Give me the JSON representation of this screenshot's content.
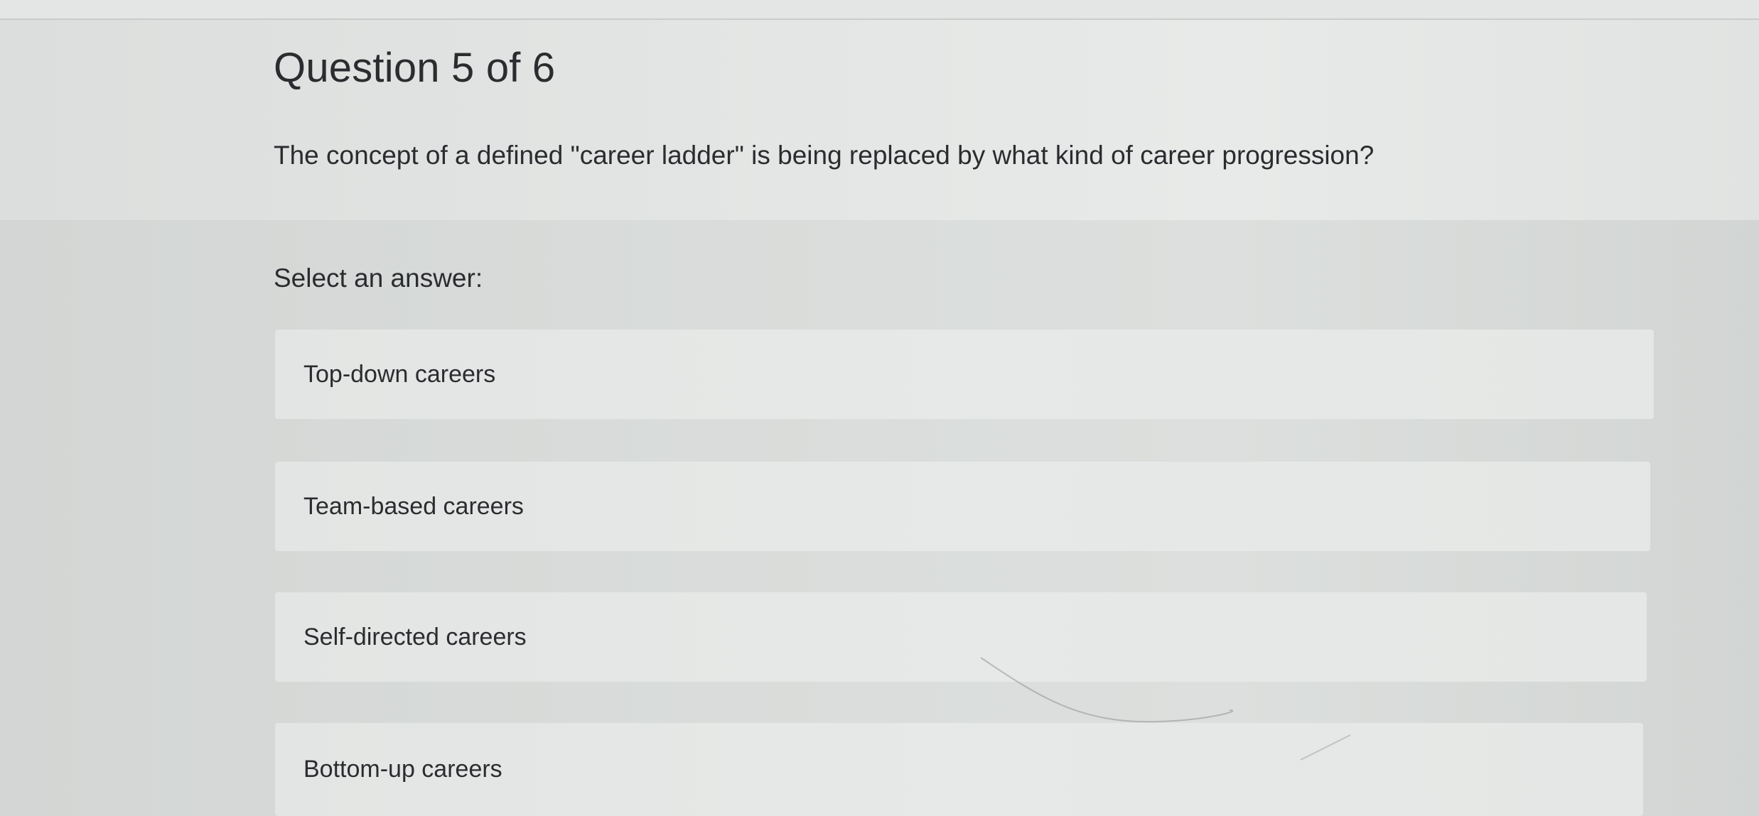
{
  "header": {
    "question_count": "Question 5 of 6",
    "question_text": "The concept of a defined \"career ladder\" is being replaced by what kind of career progression?"
  },
  "answers": {
    "select_label": "Select an answer:",
    "options": [
      {
        "label": "Top-down careers"
      },
      {
        "label": "Team-based careers"
      },
      {
        "label": "Self-directed careers"
      },
      {
        "label": "Bottom-up careers"
      }
    ]
  },
  "colors": {
    "text": "#2a2c2f",
    "header_bg": "#e4e6e5",
    "answers_bg": "#d9dcda",
    "option_bg": "#e5e7e6"
  }
}
